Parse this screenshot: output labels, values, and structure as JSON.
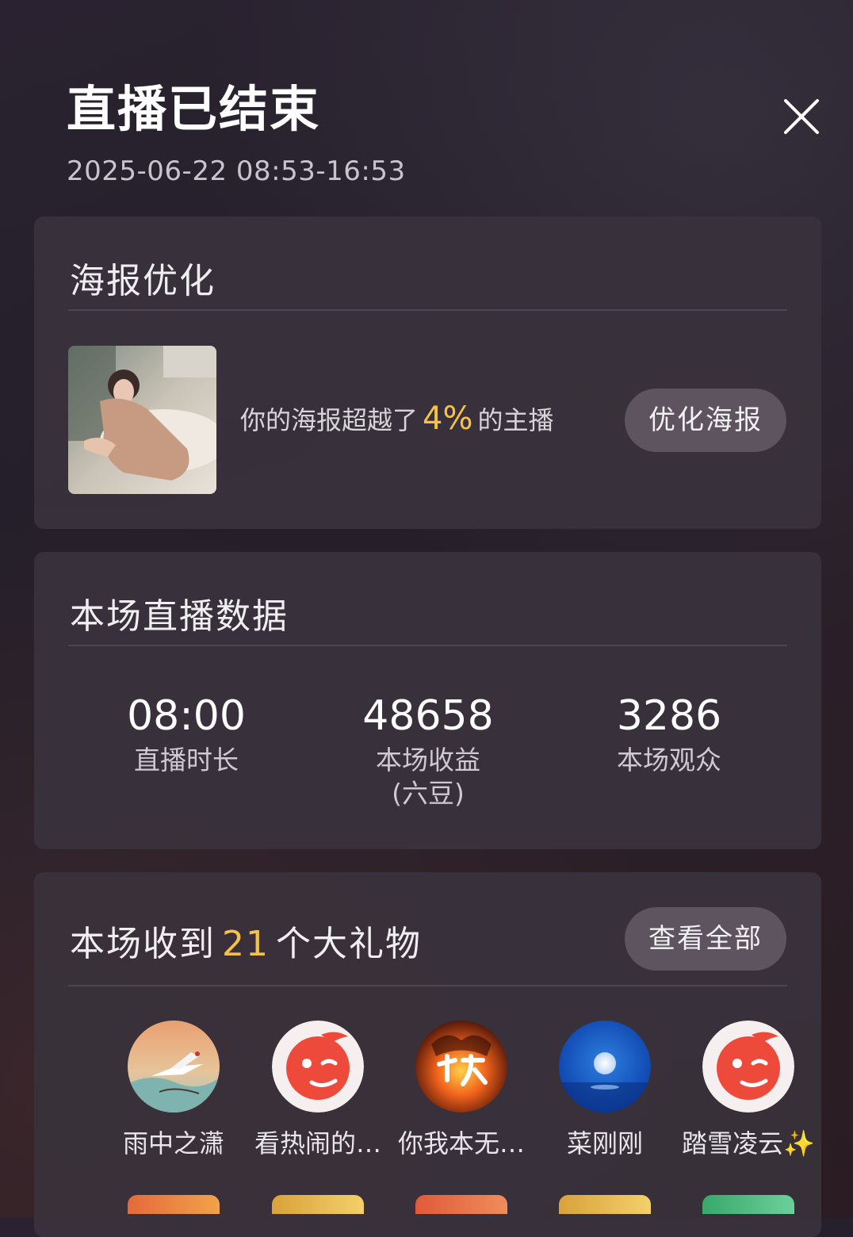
{
  "header": {
    "title": "直播已结束",
    "time_range": "2025-06-22 08:53-16:53"
  },
  "poster": {
    "title": "海报优化",
    "text_prefix": "你的海报超越了",
    "percent": "4%",
    "text_suffix": "的主播",
    "button_label": "优化海报"
  },
  "stats": {
    "title": "本场直播数据",
    "items": [
      {
        "value": "08:00",
        "label": "直播时长",
        "label2": ""
      },
      {
        "value": "48658",
        "label": "本场收益",
        "label2": "(六豆)"
      },
      {
        "value": "3286",
        "label": "本场观众",
        "label2": ""
      }
    ]
  },
  "gifts": {
    "title_prefix": "本场收到",
    "count": "21",
    "title_suffix": "个大礼物",
    "button_label": "查看全部",
    "gifters": [
      {
        "name": "雨中之潇",
        "avatar": "crane-painting-avatar"
      },
      {
        "name": "看热闹的…",
        "avatar": "red-wink-avatar"
      },
      {
        "name": "你我本无…",
        "avatar": "fire-calligraphy-avatar"
      },
      {
        "name": "菜刚刚",
        "avatar": "blue-moon-avatar"
      },
      {
        "name": "踏雪凌云✨",
        "avatar": "red-wink-avatar"
      }
    ]
  },
  "colors": {
    "highlight": "#f4c24a",
    "card_bg": "#3a323c",
    "pill_bg": "#5e5460"
  }
}
